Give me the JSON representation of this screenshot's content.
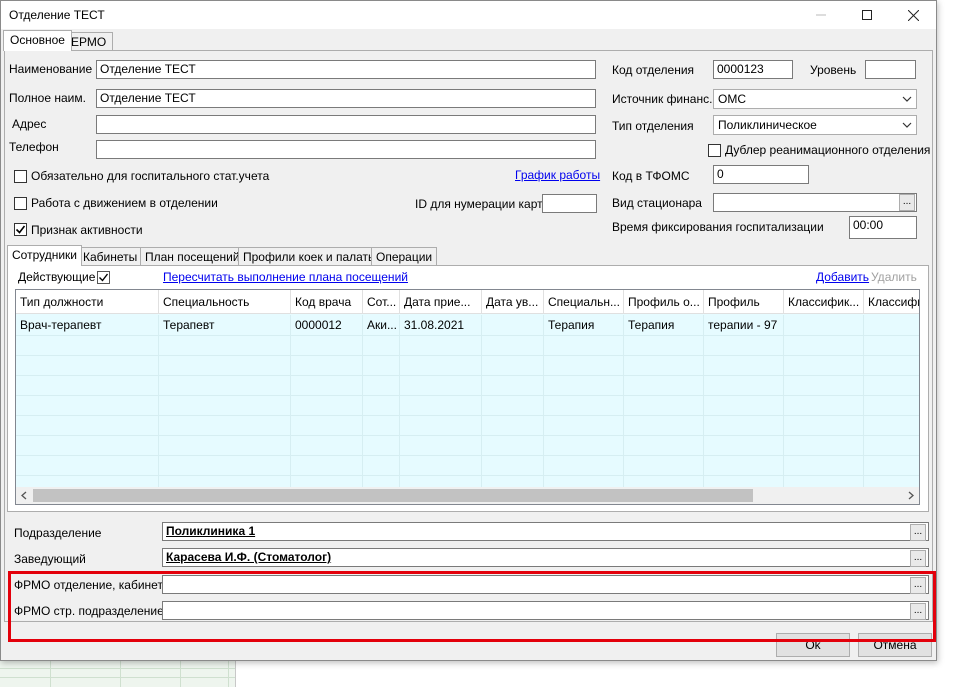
{
  "window": {
    "title": "Отделение ТЕСТ"
  },
  "top_tabs": [
    {
      "label": "Основное"
    },
    {
      "label": "ЕРМО"
    }
  ],
  "form": {
    "name": {
      "label": "Наименование",
      "value": "Отделение ТЕСТ"
    },
    "full_name": {
      "label": "Полное наим.",
      "value": "Отделение ТЕСТ"
    },
    "address": {
      "label": "Адрес",
      "value": ""
    },
    "phone": {
      "label": "Телефон",
      "value": ""
    },
    "hospital_stat": {
      "label": "Обязательно для госпитального стат.учета",
      "checked": false
    },
    "work_schedule_link": "График работы",
    "movement": {
      "label": "Работа с движением в отделении",
      "checked": false
    },
    "card_id": {
      "label": "ID для нумерации карт",
      "value": ""
    },
    "active": {
      "label": "Признак активности",
      "checked": true
    },
    "dept_code": {
      "label": "Код отделения",
      "value": "0000123"
    },
    "level": {
      "label": "Уровень",
      "value": ""
    },
    "finance_source": {
      "label": "Источник финанс.",
      "value": "ОМС"
    },
    "dept_type": {
      "label": "Тип отделения",
      "value": "Поликлиническое"
    },
    "reanimation_dup": {
      "label": "Дублер реанимационного отделения",
      "checked": false
    },
    "tfoms_code": {
      "label": "Код в ТФОМС",
      "value": "0"
    },
    "stationary_type": {
      "label": "Вид стационара",
      "value": ""
    },
    "hosp_fix_time": {
      "label": "Время фиксирования госпитализации",
      "value": "00:00"
    }
  },
  "inner_tabs": [
    {
      "label": "Сотрудники"
    },
    {
      "label": "Кабинеты"
    },
    {
      "label": "План посещений"
    },
    {
      "label": "Профили коек и палаты"
    },
    {
      "label": "Операции"
    }
  ],
  "staff": {
    "active_label": "Действующие",
    "active_checked": true,
    "recalc_link": "Пересчитать выполнение плана посещений",
    "add_link": "Добавить",
    "delete_link": "Удалить",
    "columns": [
      "Тип должности",
      "Специальность",
      "Код врача",
      "Сот...",
      "Дата прие...",
      "Дата ув...",
      "Специальн...",
      "Профиль о...",
      "Профиль",
      "Классифик...",
      "Классифи"
    ],
    "rows": [
      [
        "Врач-терапевт",
        "Терапевт",
        "0000012",
        "Аки...",
        "31.08.2021",
        "",
        "Терапия",
        "Терапия",
        "терапии - 97",
        "",
        ""
      ]
    ]
  },
  "bottom": {
    "subdivision": {
      "label": "Подразделение",
      "value": "Поликлиника 1"
    },
    "head": {
      "label": "Заведующий",
      "value": "Карасева И.Ф. (Стоматолог)"
    },
    "frmo_dept": {
      "label": "ФРМО отделение, кабинет",
      "value": ""
    },
    "frmo_subdiv": {
      "label": "ФРМО стр. подразделение",
      "value": ""
    }
  },
  "buttons": {
    "ok": "Ok",
    "cancel": "Отмена",
    "ellipsis": "..."
  },
  "colors": {
    "grid_bg": "#e6fbff",
    "highlight": "#e3000b",
    "link": "#0000ee"
  }
}
